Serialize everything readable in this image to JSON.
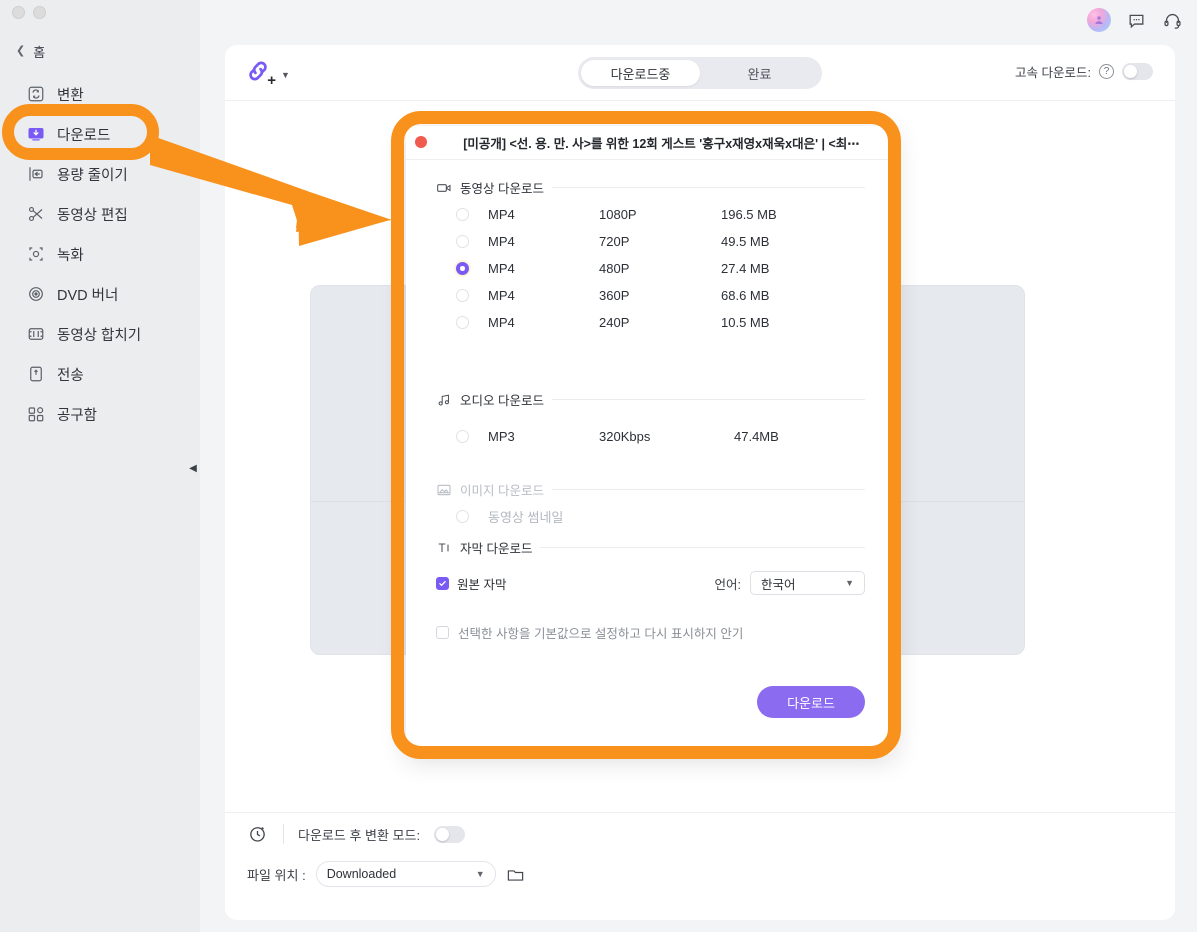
{
  "window": {
    "controls": [
      "minimize",
      "maximize"
    ]
  },
  "sidebar": {
    "home_label": "홈",
    "items": [
      {
        "label": "변환",
        "icon": "convert-icon"
      },
      {
        "label": "다운로드",
        "icon": "download-icon"
      },
      {
        "label": "용량 줄이기",
        "icon": "compress-icon"
      },
      {
        "label": "동영상 편집",
        "icon": "scissors-icon"
      },
      {
        "label": "녹화",
        "icon": "record-icon"
      },
      {
        "label": "DVD 버너",
        "icon": "disc-icon"
      },
      {
        "label": "동영상 합치기",
        "icon": "merge-icon"
      },
      {
        "label": "전송",
        "icon": "transfer-icon"
      },
      {
        "label": "공구함",
        "icon": "toolbox-icon"
      }
    ],
    "active_index": 1,
    "collapse_icon": "chevron-left-icon"
  },
  "topbar": {
    "icons": [
      "avatar",
      "feedback-bubble-icon",
      "support-headset-icon"
    ]
  },
  "header": {
    "add_link_icon": "add-link-icon",
    "add_link_caret": "chevron-down-icon",
    "tabs": [
      {
        "label": "다운로드중",
        "active": true
      },
      {
        "label": "완료",
        "active": false
      }
    ],
    "speed_label": "고속 다운로드:",
    "help_icon": "question-mark-icon",
    "speed_toggle": "off"
  },
  "modal": {
    "close_icon": "close-dot-icon",
    "title": "[미공개] <선. 용. 만. 사>를 위한 12회 게스트 '홍구x재영x재욱x대은' | <최⋯",
    "video_section": {
      "icon": "video-camera-icon",
      "title": "동영상 다운로드",
      "rows": [
        {
          "format": "MP4",
          "resolution": "1080P",
          "size": "196.5 MB",
          "selected": false
        },
        {
          "format": "MP4",
          "resolution": "720P",
          "size": "49.5 MB",
          "selected": false
        },
        {
          "format": "MP4",
          "resolution": "480P",
          "size": "27.4 MB",
          "selected": true
        },
        {
          "format": "MP4",
          "resolution": "360P",
          "size": "68.6 MB",
          "selected": false
        },
        {
          "format": "MP4",
          "resolution": "240P",
          "size": "10.5 MB",
          "selected": false
        }
      ]
    },
    "audio_section": {
      "icon": "music-note-icon",
      "title": "오디오 다운로드",
      "rows": [
        {
          "format": "MP3",
          "bitrate": "320Kbps",
          "size": "47.4MB",
          "selected": false
        }
      ]
    },
    "image_section": {
      "icon": "image-icon",
      "title": "이미지 다운로드",
      "disabled": true,
      "rows": [
        {
          "label": "동영상 썸네일",
          "selected": false
        }
      ]
    },
    "subtitle_section": {
      "icon": "subtitle-text-icon",
      "title": "자막 다운로드",
      "checkbox_label": "원본 자막",
      "checkbox_checked": true,
      "language_label": "언어:",
      "language_value": "한국어",
      "language_caret": "chevron-down-icon"
    },
    "default_checkbox": {
      "label": "선택한 사항을 기본값으로 설정하고 다시 표시하지 안기",
      "checked": false
    },
    "download_button": "다운로드"
  },
  "footer": {
    "clock_icon": "clock-icon",
    "convert_after_label": "다운로드 후 변환 모드:",
    "convert_after_toggle": "off",
    "path_label": "파일 위치 :",
    "path_value": "Downloaded",
    "path_caret": "chevron-down-icon",
    "folder_icon": "folder-icon"
  },
  "annotation": {
    "color": "#F8921C",
    "shapes": [
      "highlight-pill-sidebar-download",
      "arrow-to-modal",
      "highlight-box-modal"
    ]
  }
}
